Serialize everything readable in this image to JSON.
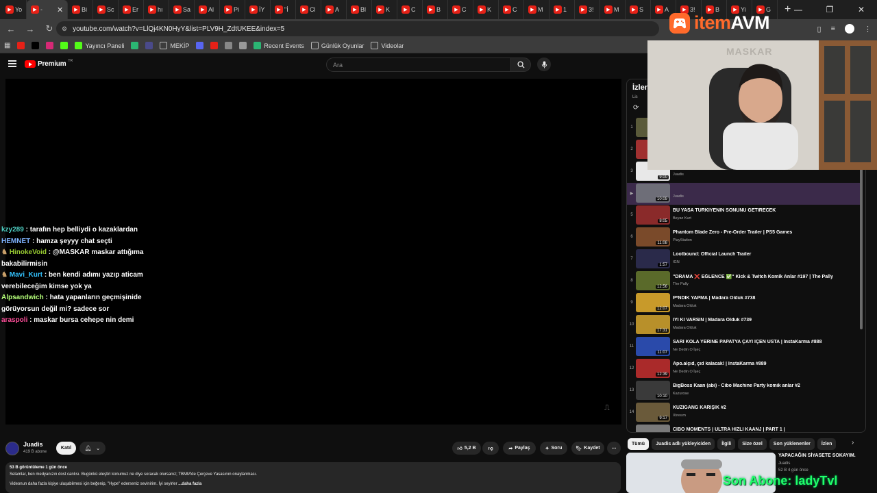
{
  "browser": {
    "tabs": [
      {
        "label": "Yo",
        "icon": "youtube-icon",
        "color": "#e62117"
      },
      {
        "label": "-",
        "icon": "youtube-icon",
        "color": "#e62117",
        "active": true
      },
      {
        "label": "Bi",
        "icon": "youtube-icon",
        "color": "#e62117"
      },
      {
        "label": "Sc",
        "icon": "youtube-icon",
        "color": "#e62117"
      },
      {
        "label": "Er",
        "icon": "youtube-icon",
        "color": "#e62117"
      },
      {
        "label": "hı",
        "icon": "youtube-icon",
        "color": "#e62117"
      },
      {
        "label": "Sa",
        "icon": "youtube-icon",
        "color": "#e62117"
      },
      {
        "label": "Al",
        "icon": "youtube-icon",
        "color": "#e62117"
      },
      {
        "label": "Pi",
        "icon": "youtube-icon",
        "color": "#e62117"
      },
      {
        "label": "İY",
        "icon": "youtube-icon",
        "color": "#e62117"
      },
      {
        "label": "\"İ",
        "icon": "youtube-icon",
        "color": "#e62117"
      },
      {
        "label": "Cl",
        "icon": "youtube-icon",
        "color": "#e62117"
      },
      {
        "label": "A",
        "icon": "youtube-icon",
        "color": "#e62117"
      },
      {
        "label": "Bl",
        "icon": "youtube-icon",
        "color": "#e62117"
      },
      {
        "label": "K",
        "icon": "youtube-icon",
        "color": "#e62117"
      },
      {
        "label": "C",
        "icon": "youtube-icon",
        "color": "#e62117"
      },
      {
        "label": "B",
        "icon": "youtube-icon",
        "color": "#e62117"
      },
      {
        "label": "C",
        "icon": "youtube-icon",
        "color": "#e62117"
      },
      {
        "label": "K",
        "icon": "youtube-icon",
        "color": "#e62117"
      },
      {
        "label": "C",
        "icon": "youtube-icon",
        "color": "#e62117"
      },
      {
        "label": "M",
        "icon": "youtube-icon",
        "color": "#e62117"
      },
      {
        "label": "1",
        "icon": "youtube-icon",
        "color": "#e62117"
      },
      {
        "label": "3!",
        "icon": "youtube-icon",
        "color": "#e62117"
      },
      {
        "label": "M",
        "icon": "youtube-icon",
        "color": "#e62117"
      },
      {
        "label": "S",
        "icon": "youtube-icon",
        "color": "#e62117"
      },
      {
        "label": "A",
        "icon": "youtube-icon",
        "color": "#e62117"
      },
      {
        "label": "3!",
        "icon": "youtube-icon",
        "color": "#e62117"
      },
      {
        "label": "B",
        "icon": "youtube-icon",
        "color": "#e62117"
      },
      {
        "label": "Yi",
        "icon": "youtube-icon",
        "color": "#e62117"
      },
      {
        "label": "G",
        "icon": "youtube-icon",
        "color": "#e62117"
      }
    ],
    "new_tab_label": "+",
    "url": "youtube.com/watch?v=LlQj4KN0HyY&list=PLV9H_ZdtUKEE&index=5",
    "bookmarks": [
      {
        "label": "",
        "icon": "youtube-icon",
        "color": "#e62117"
      },
      {
        "label": "",
        "icon": "x-icon",
        "color": "#000000"
      },
      {
        "label": "",
        "icon": "instagram-icon",
        "color": "#d62976"
      },
      {
        "label": "",
        "icon": "kick-icon",
        "color": "#53fc18"
      },
      {
        "label": "Yayıncı Paneli",
        "icon": "kick-icon",
        "color": "#53fc18"
      },
      {
        "label": "",
        "icon": "app-icon",
        "color": "#2bb673"
      },
      {
        "label": "",
        "icon": "play-icon",
        "color": "#4a4a8a"
      },
      {
        "label": "MEKİP",
        "icon": "folder-icon",
        "color": "#bbbbbb"
      },
      {
        "label": "",
        "icon": "discord-icon",
        "color": "#5865f2"
      },
      {
        "label": "",
        "icon": "youtube-icon",
        "color": "#e62117"
      },
      {
        "label": "",
        "icon": "image-icon",
        "color": "#888888"
      },
      {
        "label": "",
        "icon": "openai-icon",
        "color": "#999999"
      },
      {
        "label": "Recent Events",
        "icon": "events-icon",
        "color": "#2bb673"
      },
      {
        "label": "Günlük Oyunlar",
        "icon": "folder-icon",
        "color": "#bbbbbb"
      },
      {
        "label": "Videolar",
        "icon": "folder-icon",
        "color": "#bbbbbb"
      }
    ]
  },
  "header": {
    "brand": "Premium",
    "region": "TR",
    "search_placeholder": "Ara"
  },
  "chat": [
    {
      "user": "kzy289",
      "color": "#4fd1c5",
      "text": ": tarafın hep belliydi o kazaklardan",
      "badge": false
    },
    {
      "user": "HEMNET",
      "color": "#7fb3ff",
      "text": ": hamza şeyyy chat seçti",
      "badge": false
    },
    {
      "user": "HinokeVoid",
      "color": "#9acd32",
      "text": ": @MASKAR maskar attığıma bakabilirmisin",
      "badge": true,
      "mention": "@MASKAR"
    },
    {
      "user": "Mavi_Kurt",
      "color": "#33c3ff",
      "text": ": ben kendi adımı yazıp aticam verebileceğim kimse yok ya",
      "badge": true
    },
    {
      "user": "Alpsandwich",
      "color": "#b6ff7a",
      "text": ": hata yapanların geçmişinide görüyorsun değil mi? sadece sor",
      "badge": false
    },
    {
      "user": "araspoli",
      "color": "#ff4f9a",
      "text": ": maskar bursa cehepe nin demi",
      "badge": false
    }
  ],
  "channel": {
    "name": "Juadis",
    "subscribers": "419 B abone",
    "join_label": "Katıl"
  },
  "actions": {
    "likes": "5,2 B",
    "share": "Paylaş",
    "ask": "Soru",
    "save": "Kaydet"
  },
  "description": {
    "views_time": "53 B görüntüleme  1 gün önce",
    "line1": "Selamlar, ben medyanızın dost canlısı. Bugünkü eleştiri konumuz ne diye soracak olursanız; TBMM'de Çerçeve Yasasının onaylanması.",
    "line2": "Videonun daha fazla kişiye ulaşabilmesi için beğenip, \"Hype\" ederseniz sevinirim. İyi seyirler",
    "more": "...daha fazla"
  },
  "playlist": {
    "title": "İzlen",
    "subtitle": "Lis",
    "items": [
      {
        "n": "1",
        "title": "",
        "channel": "",
        "duration": "",
        "thumb": "#5a5a3a"
      },
      {
        "n": "2",
        "title": "",
        "channel": "",
        "duration": "",
        "thumb": "#a03030"
      },
      {
        "n": "3",
        "title": "",
        "channel": "Juadis",
        "duration": "9:00",
        "thumb": "#e8e8e8"
      },
      {
        "n": "▶",
        "title": "",
        "channel": "Juadis",
        "duration": "10:09",
        "thumb": "#6e6e78",
        "current": true
      },
      {
        "n": "5",
        "title": "BU YASA TÜRKİYENİN SONUNU GETİRECEK",
        "channel": "Beyaz Kurt",
        "duration": "8:05",
        "thumb": "#8a2a2a"
      },
      {
        "n": "6",
        "title": "Phantom Blade Zero - Pre-Order Trailer | PS5 Games",
        "channel": "PlayStation",
        "duration": "11:08",
        "thumb": "#7a4a2a"
      },
      {
        "n": "7",
        "title": "Lootbound: Official Launch Trailer",
        "channel": "IGN",
        "duration": "1:57",
        "thumb": "#2a2a4a"
      },
      {
        "n": "8",
        "title": "\"DRAMA ❌ EĞLENCE ✅\" Kick & Twitch Komik Anlar #197 | The Pally",
        "channel": "The Pally",
        "duration": "12:56",
        "thumb": "#5a6a2a"
      },
      {
        "n": "9",
        "title": "P*NDİK YAPMA | Madara Olduk #738",
        "channel": "Madara Olduk",
        "duration": "12:07",
        "thumb": "#c89a2a"
      },
      {
        "n": "10",
        "title": "İYİ Kİ VARSIN | Madara Olduk #739",
        "channel": "Madara Olduk",
        "duration": "17:31",
        "thumb": "#b8902a"
      },
      {
        "n": "11",
        "title": "SARI KOLA YERİNE PAPATYA ÇAYI İÇEN USTA | InstaKarma #888",
        "channel": "Ne Dedin O İşeç",
        "duration": "11:07",
        "thumb": "#2a4aaa"
      },
      {
        "n": "12",
        "title": "Apo.alçıd, çıd kalacak! | InstaKarma #889",
        "channel": "Ne Dedin O İşeç",
        "duration": "12:39",
        "thumb": "#aa2a2a"
      },
      {
        "n": "13",
        "title": "BigBoss Kaan (abi) - Cibo Machine Party komik anlar #2",
        "channel": "Kazurose",
        "duration": "10:10",
        "thumb": "#3a3a3a"
      },
      {
        "n": "14",
        "title": "KUZİGANG KARIŞIK #2",
        "channel": "Xtresım",
        "duration": "9:17",
        "thumb": "#6a5a3a"
      },
      {
        "n": "15",
        "title": "CİBO MOMENTS | ULTRA HIZLI KAANJ | PART 1 |",
        "channel": "",
        "duration": "",
        "thumb": "#7a7a7a"
      }
    ]
  },
  "chips": [
    "Tümü",
    "Juadis adlı yükleyiciden",
    "İlgili",
    "Size özel",
    "Son yüklenenler",
    "İzlen"
  ],
  "recommendation": {
    "title": "YAPACAĞIN SİYASETE SOKAYIM.",
    "channel": "Juadis",
    "meta": "52 B  4 gün önce"
  },
  "overlays": {
    "watermark_item": "item",
    "watermark_avm": "AVM",
    "webcam_wall_text": "MASKAR",
    "banner": "Son Abone: ladyTvl"
  }
}
